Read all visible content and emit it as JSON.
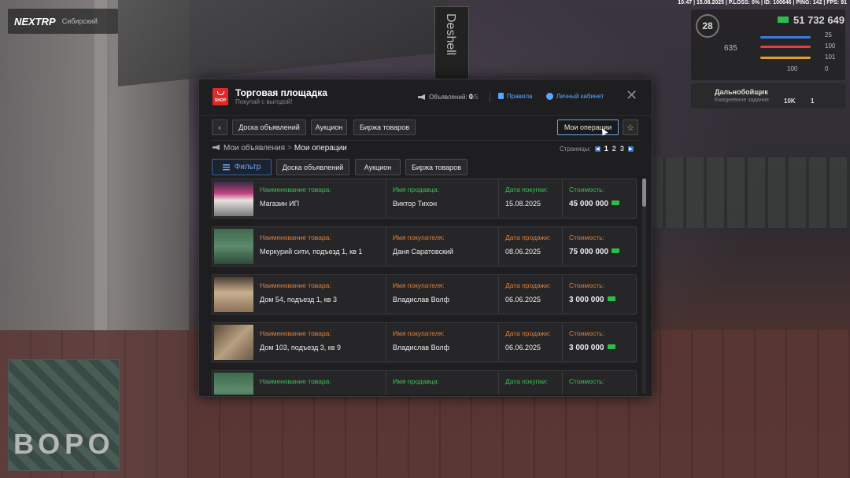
{
  "topbar": "10:47 | 15.08.2025 | P.LOSS: 0% | ID: 100646 | PING: 142 | FPS: 91",
  "hud": {
    "brand": "NEXTRP",
    "server": "Сибирский",
    "level": "28",
    "money": "51 732 649",
    "stat_a": "635",
    "stat_25": "25",
    "stat_100": "100",
    "stat_101": "101",
    "stat_100b": "100",
    "stat_0": "0",
    "job_title": "Дальнобойщик",
    "job_sub": "Ежедневное задание",
    "job_val1": "10K",
    "job_val2": "1"
  },
  "minimap_text": "ВОРО",
  "background_sign": "Deshell",
  "modal": {
    "title": "Торговая площадка",
    "subtitle": "Покупай с выгодой!",
    "shop_icon_text": "SHOP",
    "ads_label": "Объявлений:",
    "ads_count": "0",
    "ads_max": "/5",
    "rules": "Правила",
    "cabinet": "Личный кабинет",
    "nav": {
      "back": "‹",
      "board": "Доска объявлений",
      "auction": "Аукцион",
      "exchange": "Биржа товаров",
      "my_ops": "Мои операции",
      "favorite": "☆"
    },
    "breadcrumb": {
      "parent": "Мои объявления",
      "sep": ">",
      "current": "Мои операции"
    },
    "pages": {
      "label": "Страницы:",
      "items": [
        "1",
        "2",
        "3"
      ],
      "current": "1"
    },
    "filters": {
      "filter": "Фильтр",
      "board": "Доска объявлений",
      "auction": "Аукцион",
      "exchange": "Биржа товаров"
    },
    "cards": [
      {
        "type": "purchase",
        "product_label": "Наименование товара:",
        "product": "Магазин ИП",
        "party_label": "Имя продавца:",
        "party": "Виктор Тихон",
        "date_label": "Дата покупки:",
        "date": "15.08.2025",
        "price_label": "Стоимость:",
        "price": "45 000 000",
        "thumb": "shop"
      },
      {
        "type": "sale",
        "product_label": "Наименование товара:",
        "product": "Меркурий сити, подъезд 1, кв 1",
        "party_label": "Имя покупателя:",
        "party": "Даня Саратовский",
        "date_label": "Дата продажи:",
        "date": "08.06.2025",
        "price_label": "Стоимость:",
        "price": "75 000 000",
        "thumb": "green"
      },
      {
        "type": "sale",
        "product_label": "Наименование товара:",
        "product": "Дом 54, подъезд 1, кв 3",
        "party_label": "Имя покупателя:",
        "party": "Владислав Волф",
        "date_label": "Дата продажи:",
        "date": "06.06.2025",
        "price_label": "Стоимость:",
        "price": "3 000 000",
        "thumb": "room"
      },
      {
        "type": "sale",
        "product_label": "Наименование товара:",
        "product": "Дом 103, подъезд 3, кв 9",
        "party_label": "Имя покупателя:",
        "party": "Владислав Волф",
        "date_label": "Дата продажи:",
        "date": "06.06.2025",
        "price_label": "Стоимость:",
        "price": "3 000 000",
        "thumb": "room2"
      },
      {
        "type": "purchase",
        "product_label": "Наименование товара:",
        "product": "",
        "party_label": "Имя продавца:",
        "party": "",
        "date_label": "Дата покупки:",
        "date": "",
        "price_label": "Стоимость:",
        "price": "",
        "thumb": "green"
      }
    ]
  },
  "colors": {
    "accent_blue": "#58a6ff",
    "purchase_label": "#3fbf57",
    "sale_label": "#e0813a",
    "money_green": "#2dbb4e",
    "shop_red": "#e02a2a"
  }
}
